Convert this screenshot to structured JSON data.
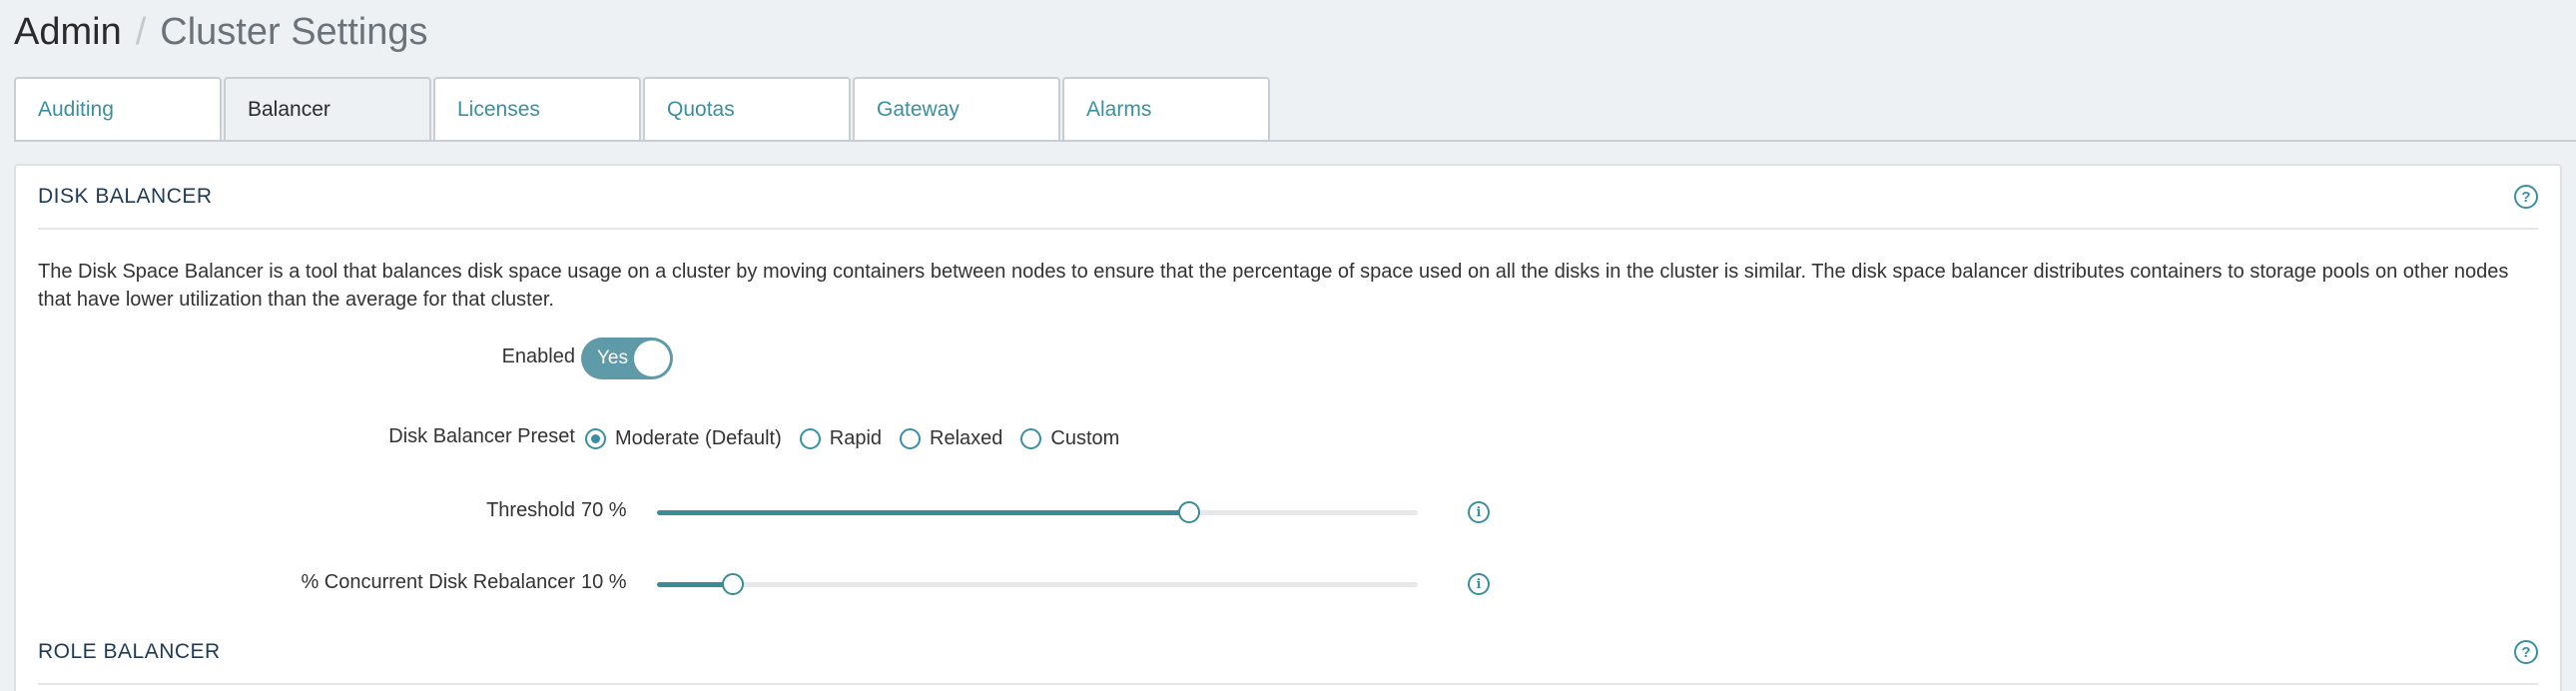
{
  "breadcrumb": {
    "root": "Admin",
    "separator": "/",
    "current": "Cluster Settings"
  },
  "tabs": [
    {
      "label": "Auditing",
      "active": false
    },
    {
      "label": "Balancer",
      "active": true
    },
    {
      "label": "Licenses",
      "active": false
    },
    {
      "label": "Quotas",
      "active": false
    },
    {
      "label": "Gateway",
      "active": false
    },
    {
      "label": "Alarms",
      "active": false
    }
  ],
  "disk_balancer": {
    "title": "DISK BALANCER",
    "description": "The Disk Space Balancer is a tool that balances disk space usage on a cluster by moving containers between nodes to ensure that the percentage of space used on all the disks in the cluster is similar. The disk space balancer distributes containers to storage pools on other nodes that have lower utilization than the average for that cluster.",
    "enabled_label": "Enabled",
    "enabled_value": "Yes",
    "preset_label": "Disk Balancer Preset",
    "presets": [
      {
        "label": "Moderate (Default)",
        "checked": true
      },
      {
        "label": "Rapid",
        "checked": false
      },
      {
        "label": "Relaxed",
        "checked": false
      },
      {
        "label": "Custom",
        "checked": false
      }
    ],
    "threshold_label": "Threshold",
    "threshold_value": "70 %",
    "threshold_fraction": 0.7,
    "concurrent_label": "% Concurrent Disk Rebalancer",
    "concurrent_value": "10 %",
    "concurrent_fraction": 0.1
  },
  "role_balancer": {
    "title": "ROLE BALANCER"
  },
  "colors": {
    "accent": "#3a8fa0",
    "toggle": "#5e9aa8",
    "slider": "#3b8c96"
  },
  "icons": {
    "help": "question-circle-icon",
    "info": "info-circle-icon"
  }
}
